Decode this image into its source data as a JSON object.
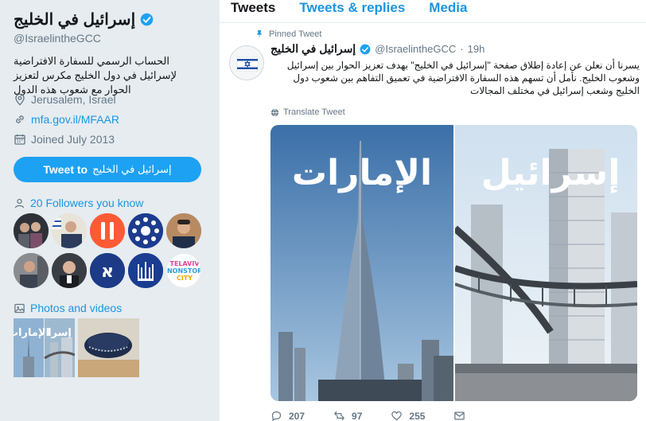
{
  "profile": {
    "name": "إسرائيل في الخليج",
    "handle": "@IsraelintheGCC",
    "bio": "الحساب الرسمي للسفارة الافتراضية لإسرائيل في دول الخليج مكرس لتعزيز الحوار مع شعوب هذه الدول",
    "location": "Jerusalem, Israel",
    "website": "mfa.gov.il/MFAAR",
    "joined": "Joined July 2013",
    "tweet_to_prefix": "Tweet to",
    "tweet_to_name": "إسرائيل في الخليج",
    "followers_you_know": "20 Followers you know",
    "photos_videos": "Photos and videos",
    "verified_color": "#1da1f2"
  },
  "followers_thumbs": [
    "avatar-1",
    "avatar-2",
    "avatar-3",
    "avatar-4",
    "avatar-5",
    "avatar-6",
    "avatar-7",
    "avatar-8",
    "avatar-9",
    "avatar-10"
  ],
  "thumb_logo_text": [
    "TELAVIV",
    "NONSTOP",
    "CITY"
  ],
  "photo_thumb_label": "الإمارات",
  "photo_thumb_label2": "إسرا",
  "tabs": [
    "Tweets",
    "Tweets & replies",
    "Media"
  ],
  "tweet": {
    "pinned_label": "Pinned Tweet",
    "name": "إسرائيل في الخليج",
    "handle": "@IsraelintheGCC",
    "sep": "·",
    "time": "19h",
    "text": "يسرنا أن نعلن عن إعادة إطلاق صفحة \"إسرائيل في الخليج\" بهدف تعزيز الحوار بين إسرائيل وشعوب الخليج. نأمل أن تسهم هذه السفارة الافتراضية في تعميق التفاهم بين شعوب دول الخليج وشعب إسرائيل في مختلف المجالات",
    "translate": "Translate Tweet",
    "media_left_label": "الإمارات",
    "media_right_label": "إسرائيل",
    "replies": "207",
    "retweets": "97",
    "likes": "255"
  },
  "colors": {
    "accent": "#1da1f2",
    "link": "#1b95e0",
    "muted": "#657786",
    "bg": "#e6ecf0"
  }
}
